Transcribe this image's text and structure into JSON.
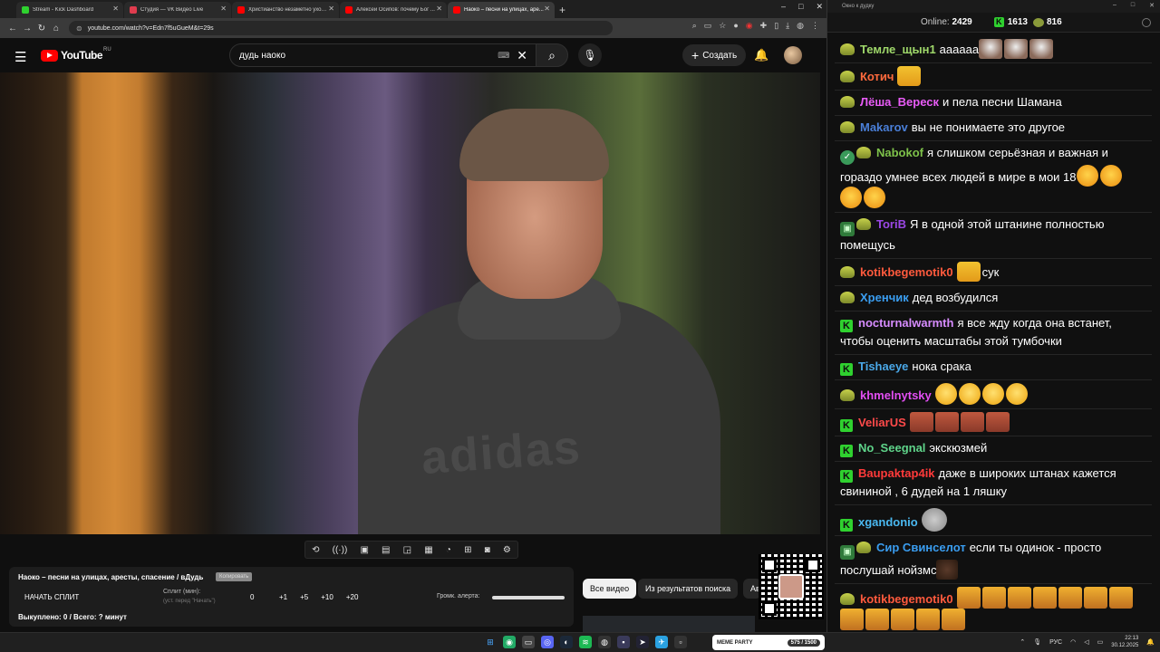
{
  "tabs": [
    {
      "title": "Stream - Kick Dashboard",
      "favicon": "kick-icon",
      "color": "#2fd12f",
      "active": false
    },
    {
      "title": "Студия — VK Видео Live",
      "favicon": "vk-video-icon",
      "color": "#e03c4e",
      "active": false
    },
    {
      "title": "Христианство незаметно уход...",
      "favicon": "youtube-icon",
      "color": "#ff0000",
      "active": false
    },
    {
      "title": "Алексей Осипов: почему Бог ...",
      "favicon": "youtube-icon",
      "color": "#ff0000",
      "active": false
    },
    {
      "title": "Наоко – песни на улицах, аре...",
      "favicon": "youtube-icon",
      "color": "#ff0000",
      "active": true
    }
  ],
  "browser": {
    "url": "youtube.com/watch?v=Edn7f5uGueM&t=29s",
    "new_tab": "+",
    "win_minimize": "–",
    "win_maximize": "□",
    "win_close": "✕"
  },
  "youtube": {
    "logo_text": "YouTube",
    "logo_region": "RU",
    "search_query": "дудь наоко",
    "create_label": "Создать",
    "brand_on_hoodie": "adidas"
  },
  "panel": {
    "video_title": "Наоко – песни на улицах, аресты, спасение / вДудь",
    "copy_label": "Копировать",
    "start_split": "НАЧАТЬ СПЛИТ",
    "split_label": "Сплит (мин):",
    "split_hint": "(уст. перед \"Начать\")",
    "split_value": "0",
    "increments": [
      "+1",
      "+5",
      "+10",
      "+20"
    ],
    "volume_label": "Громк. алерта:",
    "bought": "Выкуплено: 0 / Всего: ? минут"
  },
  "chips": {
    "all_videos": "Все видео",
    "from_search": "Из результатов поиска",
    "third": "Ав"
  },
  "chat_window": {
    "title": "Окно к дудку",
    "online_label": "Online:",
    "online_count": "2429",
    "kick_count": "1613",
    "vk_count": "816"
  },
  "chat": [
    {
      "user": "Темле_щын1",
      "color": "#9fd86a",
      "badges": [
        "bp"
      ],
      "text": "аааааа",
      "emotes": [
        "dog",
        "dog",
        "dog"
      ],
      "emotes_after": []
    },
    {
      "user": "Котич",
      "color": "#ff6a3d",
      "badges": [
        "bp"
      ],
      "text": "",
      "emotes": [
        "yel"
      ],
      "emotes_after": []
    },
    {
      "user": "Лёша_Вереск",
      "color": "#e95cf7",
      "badges": [
        "bp"
      ],
      "text": "и пела песни Шамана",
      "emotes": [],
      "emotes_after": []
    },
    {
      "user": "Makarov",
      "color": "#4a7fd8",
      "badges": [
        "bp"
      ],
      "text": "вы не понимаете это другое",
      "emotes": [],
      "emotes_after": []
    },
    {
      "user": "Nabokof",
      "color": "#7ec24a",
      "badges": [
        "vb",
        "bp"
      ],
      "text": "я слишком серьёзная и важная и гораздо умнее всех людей в мире в мои 18",
      "emotes": [
        "cry"
      ],
      "emotes_after": [
        "cry",
        "cry",
        "cry"
      ]
    },
    {
      "user": "ToriB",
      "color": "#9b47e6",
      "badges": [
        "sb",
        "bp"
      ],
      "text": "Я в одной этой штанине полностью помещусь",
      "emotes": [],
      "emotes_after": []
    },
    {
      "user": "kotikbegemotik0",
      "color": "#ff5a3d",
      "badges": [
        "bp"
      ],
      "text": "сук",
      "emotes": [],
      "emotes_before": [
        "yel"
      ],
      "emotes_after": []
    },
    {
      "user": "Хренчик",
      "color": "#3a9df0",
      "badges": [
        "bp"
      ],
      "text": "дед возбудился",
      "emotes": [],
      "emotes_after": []
    },
    {
      "user": "nocturnalwarmth",
      "color": "#d78cff",
      "badges": [
        "kb"
      ],
      "text": "я все жду когда она встанет, чтобы оценить масштабы этой тумбочки",
      "emotes": [],
      "emotes_after": []
    },
    {
      "user": "Tishaeye",
      "color": "#4aa8e8",
      "badges": [
        "kb"
      ],
      "text": "нока срака",
      "emotes": [],
      "emotes_after": []
    },
    {
      "user": "khmelnytsky",
      "color": "#e24ef2",
      "badges": [
        "bp"
      ],
      "text": "",
      "emotes": [
        "think",
        "think",
        "think",
        "think"
      ],
      "emotes_after": []
    },
    {
      "user": "VeliarUS",
      "color": "#ff4a4a",
      "badges": [
        "kb"
      ],
      "text": "",
      "emotes": [
        "face",
        "face",
        "face",
        "face"
      ],
      "emotes_after": []
    },
    {
      "user": "No_Seegnal",
      "color": "#5fd48a",
      "badges": [
        "kb"
      ],
      "text": "экскюзмей",
      "emotes": [],
      "emotes_after": []
    },
    {
      "user": "Baupaktap4ik",
      "color": "#ff3a3a",
      "badges": [
        "kb"
      ],
      "text": "даже в широких штанах кажется свининой , 6 дудей на 1 ляшку",
      "emotes": [],
      "emotes_after": []
    },
    {
      "user": "xgandonio",
      "color": "#4ab8f0",
      "badges": [
        "kb"
      ],
      "text": "",
      "emotes": [
        "cat"
      ],
      "emotes_after": []
    },
    {
      "user": "Сир Свинселот",
      "color": "#3a9df0",
      "badges": [
        "sb",
        "bp"
      ],
      "text": "если ты одинок - просто послушай нойзмс",
      "emotes": [],
      "emotes_after": [
        "deer"
      ]
    },
    {
      "user": "kotikbegemotik0",
      "color": "#ff5a3d",
      "badges": [
        "bp"
      ],
      "text": "",
      "emotes": [
        "tiger",
        "tiger",
        "tiger",
        "tiger",
        "tiger",
        "tiger",
        "tiger",
        "tiger",
        "tiger",
        "tiger",
        "tiger",
        "tiger"
      ],
      "emotes_after": []
    }
  ],
  "taskbar": {
    "app_label": "MEME PARTY",
    "app_progress": "575 / 1500",
    "lang": "РУС",
    "time": "22:13",
    "date": "30.12.2025"
  }
}
